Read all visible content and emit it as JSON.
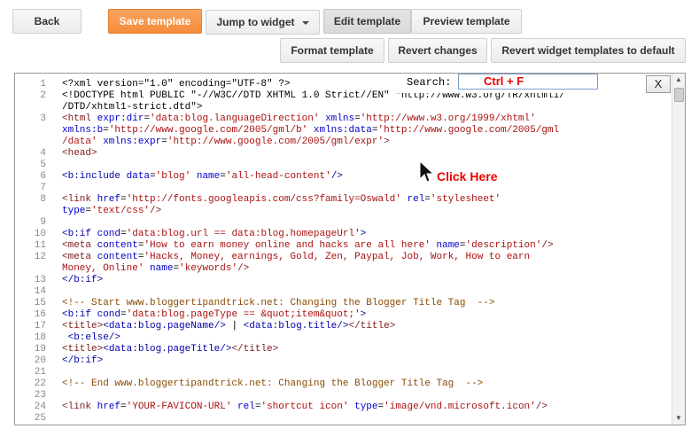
{
  "toolbar": {
    "back": "Back",
    "save_template": "Save template",
    "jump_to_widget": "Jump to widget",
    "edit_template": "Edit template",
    "preview_template": "Preview template",
    "format_template": "Format template",
    "revert_changes": "Revert changes",
    "revert_widgets": "Revert widget templates to default"
  },
  "search": {
    "label": "Search:",
    "value": "Ctrl + F",
    "close": "X"
  },
  "annotation": {
    "text": "Click Here"
  },
  "colors": {
    "primary": "#f58c3a",
    "annotation": "#e00000"
  },
  "lines": [
    {
      "n": "1",
      "segs": [
        {
          "c": "blk",
          "t": "<?xml version=\"1.0\" encoding=\"UTF-8\" ?>"
        }
      ]
    },
    {
      "n": "2",
      "segs": [
        {
          "c": "blk",
          "t": "<!DOCTYPE html PUBLIC \"-//W3C//DTD XHTML 1.0 Strict//EN\" \"http://www.w3.org/TR/xhtml1/"
        }
      ]
    },
    {
      "n": "",
      "segs": [
        {
          "c": "blk",
          "t": "/DTD/xhtml1-strict.dtd\">"
        }
      ]
    },
    {
      "n": "3",
      "segs": [
        {
          "c": "tag",
          "t": "<html "
        },
        {
          "c": "attr",
          "t": "expr:dir"
        },
        {
          "c": "blk",
          "t": "="
        },
        {
          "c": "str",
          "t": "'data:blog.languageDirection'"
        },
        {
          "c": "attr",
          "t": " xmlns"
        },
        {
          "c": "blk",
          "t": "="
        },
        {
          "c": "str",
          "t": "'http://www.w3.org/1999/xhtml'"
        }
      ]
    },
    {
      "n": "",
      "segs": [
        {
          "c": "attr",
          "t": "xmlns:b"
        },
        {
          "c": "blk",
          "t": "="
        },
        {
          "c": "str",
          "t": "'http://www.google.com/2005/gml/b'"
        },
        {
          "c": "attr",
          "t": " xmlns:data"
        },
        {
          "c": "blk",
          "t": "="
        },
        {
          "c": "str",
          "t": "'http://www.google.com/2005/gml"
        }
      ]
    },
    {
      "n": "",
      "segs": [
        {
          "c": "str",
          "t": "/data'"
        },
        {
          "c": "attr",
          "t": " xmlns:expr"
        },
        {
          "c": "blk",
          "t": "="
        },
        {
          "c": "str",
          "t": "'http://www.google.com/2005/gml/expr'"
        },
        {
          "c": "tag",
          "t": ">"
        }
      ]
    },
    {
      "n": "4",
      "segs": [
        {
          "c": "tag",
          "t": "<head>"
        }
      ]
    },
    {
      "n": "5",
      "segs": []
    },
    {
      "n": "6",
      "segs": [
        {
          "c": "kw",
          "t": "<b:include "
        },
        {
          "c": "attr",
          "t": "data"
        },
        {
          "c": "blk",
          "t": "="
        },
        {
          "c": "str",
          "t": "'blog'"
        },
        {
          "c": "attr",
          "t": " name"
        },
        {
          "c": "blk",
          "t": "="
        },
        {
          "c": "str",
          "t": "'all-head-content'"
        },
        {
          "c": "kw",
          "t": "/>"
        }
      ]
    },
    {
      "n": "7",
      "segs": []
    },
    {
      "n": "8",
      "segs": [
        {
          "c": "tag",
          "t": "<link "
        },
        {
          "c": "attr",
          "t": "href"
        },
        {
          "c": "blk",
          "t": "="
        },
        {
          "c": "str",
          "t": "'http://fonts.googleapis.com/css?family=Oswald'"
        },
        {
          "c": "attr",
          "t": " rel"
        },
        {
          "c": "blk",
          "t": "="
        },
        {
          "c": "str",
          "t": "'stylesheet'"
        }
      ]
    },
    {
      "n": "",
      "segs": [
        {
          "c": "attr",
          "t": "type"
        },
        {
          "c": "blk",
          "t": "="
        },
        {
          "c": "str",
          "t": "'text/css'"
        },
        {
          "c": "tag",
          "t": "/>"
        }
      ]
    },
    {
      "n": "9",
      "segs": []
    },
    {
      "n": "10",
      "segs": [
        {
          "c": "kw",
          "t": "<b:if "
        },
        {
          "c": "attr",
          "t": "cond"
        },
        {
          "c": "blk",
          "t": "="
        },
        {
          "c": "str",
          "t": "'data:blog.url == data:blog.homepageUrl'"
        },
        {
          "c": "kw",
          "t": ">"
        }
      ]
    },
    {
      "n": "11",
      "segs": [
        {
          "c": "tag",
          "t": "<meta "
        },
        {
          "c": "attr",
          "t": "content"
        },
        {
          "c": "blk",
          "t": "="
        },
        {
          "c": "str",
          "t": "'How to earn money online and hacks are all here'"
        },
        {
          "c": "attr",
          "t": " name"
        },
        {
          "c": "blk",
          "t": "="
        },
        {
          "c": "str",
          "t": "'description'"
        },
        {
          "c": "tag",
          "t": "/>"
        }
      ]
    },
    {
      "n": "12",
      "segs": [
        {
          "c": "tag",
          "t": "<meta "
        },
        {
          "c": "attr",
          "t": "content"
        },
        {
          "c": "blk",
          "t": "="
        },
        {
          "c": "str",
          "t": "'Hacks, Money, earnings, Gold, Zen, Paypal, Job, Work, How to earn"
        }
      ]
    },
    {
      "n": "",
      "segs": [
        {
          "c": "str",
          "t": "Money, Online'"
        },
        {
          "c": "attr",
          "t": " name"
        },
        {
          "c": "blk",
          "t": "="
        },
        {
          "c": "str",
          "t": "'keywords'"
        },
        {
          "c": "tag",
          "t": "/>"
        }
      ]
    },
    {
      "n": "13",
      "segs": [
        {
          "c": "kw",
          "t": "</b:if>"
        }
      ]
    },
    {
      "n": "14",
      "segs": []
    },
    {
      "n": "15",
      "segs": [
        {
          "c": "cmt",
          "t": "<!-- Start www.bloggertipandtrick.net: Changing the Blogger Title Tag  -->"
        }
      ]
    },
    {
      "n": "16",
      "segs": [
        {
          "c": "kw",
          "t": "<b:if "
        },
        {
          "c": "attr",
          "t": "cond"
        },
        {
          "c": "blk",
          "t": "="
        },
        {
          "c": "str",
          "t": "'data:blog.pageType == &quot;item&quot;'"
        },
        {
          "c": "kw",
          "t": ">"
        }
      ]
    },
    {
      "n": "17",
      "segs": [
        {
          "c": "tag",
          "t": "<title>"
        },
        {
          "c": "kw",
          "t": "<data:blog.pageName/>"
        },
        {
          "c": "blk",
          "t": " | "
        },
        {
          "c": "kw",
          "t": "<data:blog.title/>"
        },
        {
          "c": "tag",
          "t": "</title>"
        }
      ]
    },
    {
      "n": "18",
      "segs": [
        {
          "c": "kw",
          "t": " <b:else/>"
        }
      ]
    },
    {
      "n": "19",
      "segs": [
        {
          "c": "tag",
          "t": "<title>"
        },
        {
          "c": "kw",
          "t": "<data:blog.pageTitle/>"
        },
        {
          "c": "tag",
          "t": "</title>"
        }
      ]
    },
    {
      "n": "20",
      "segs": [
        {
          "c": "kw",
          "t": "</b:if>"
        }
      ]
    },
    {
      "n": "21",
      "segs": []
    },
    {
      "n": "22",
      "segs": [
        {
          "c": "cmt",
          "t": "<!-- End www.bloggertipandtrick.net: Changing the Blogger Title Tag  -->"
        }
      ]
    },
    {
      "n": "23",
      "segs": []
    },
    {
      "n": "24",
      "segs": [
        {
          "c": "tag",
          "t": "<link "
        },
        {
          "c": "attr",
          "t": "href"
        },
        {
          "c": "blk",
          "t": "="
        },
        {
          "c": "str",
          "t": "'YOUR-FAVICON-URL'"
        },
        {
          "c": "attr",
          "t": " rel"
        },
        {
          "c": "blk",
          "t": "="
        },
        {
          "c": "str",
          "t": "'shortcut icon'"
        },
        {
          "c": "attr",
          "t": " type"
        },
        {
          "c": "blk",
          "t": "="
        },
        {
          "c": "str",
          "t": "'image/vnd.microsoft.icon'"
        },
        {
          "c": "tag",
          "t": "/>"
        }
      ]
    },
    {
      "n": "25",
      "segs": []
    }
  ]
}
